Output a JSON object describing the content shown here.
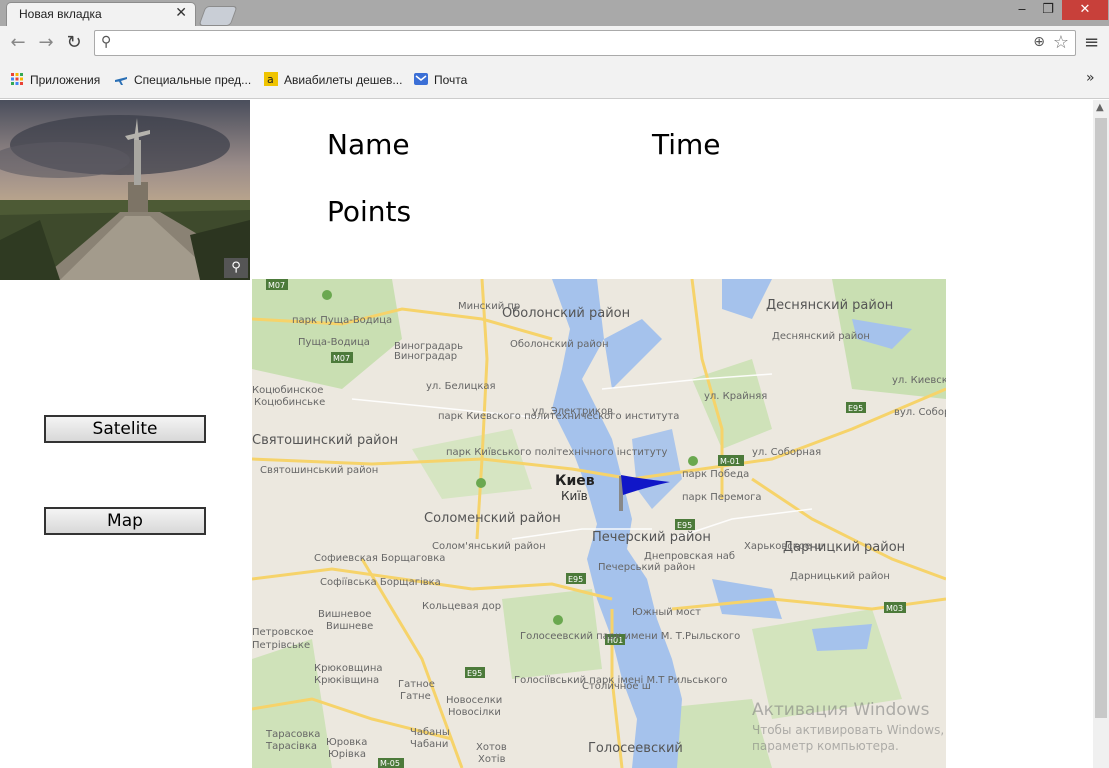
{
  "browser": {
    "tab_title": "Новая вкладка",
    "tab_close": "✕",
    "window_buttons": {
      "minimize": "‒",
      "maximize": "❐",
      "close": "✕"
    },
    "address_value": "",
    "bookmarks": [
      {
        "label": "Приложения",
        "icon": "apps-grid-icon",
        "color": "#e94235"
      },
      {
        "label": "Специальные пред...",
        "icon": "plane-icon",
        "color": "#2a6fb5"
      },
      {
        "label": "Авиабилеты дешев...",
        "icon": "amazon-a-icon",
        "color": "#f0c400"
      },
      {
        "label": "Почта",
        "icon": "mail-icon",
        "color": "#3b6fd6"
      }
    ],
    "bookmarks_more": "»"
  },
  "panel": {
    "name_label": "Name",
    "time_label": "Time",
    "points_label": "Points",
    "satellite_button": "Satelite",
    "map_button": "Map"
  },
  "map": {
    "labels": {
      "obolon": "Оболонский район",
      "obolon_small": "Оболонский район",
      "desnyan": "Деснянский район",
      "desnyan_small": "Деснянский район",
      "pushcha": "парк Пуща-Водица",
      "pushcha_small": "Пуща-Водица",
      "vinogradar": "Виноградарь",
      "vinogradar2": "Виноградар",
      "kotsyub": "Коцюбинское",
      "kotsyub2": "Коцюбинське",
      "svyatoshin": "Святошинский район",
      "svyatoshin_small": "Святошинський район",
      "kpi": "парк Киевского политехнического института",
      "kpi_small": "парк Київського політехнічного інституту",
      "kiev": "Киев",
      "kyiv": "Київ",
      "pobeda": "парк Победа",
      "peremoga": "парк Перемога",
      "solomen": "Соломенский район",
      "solomen_small": "Солом'янський район",
      "pechersk": "Печерский район",
      "pechersk_small": "Печерський район",
      "darnit": "Дарницкий район",
      "darnit_small": "Дарницький район",
      "sofiev": "Софиевская Борщаговка",
      "sofiev_small": "Софіївська Борщагівка",
      "vishnevoe": "Вишневое",
      "vishneve": "Вишневе",
      "petrov": "Петровское",
      "petriv": "Петрівське",
      "kryuk": "Крюковщина",
      "kryuk2": "Крюківщина",
      "gatnoe": "Гатное",
      "gatne": "Гатне",
      "novos": "Новоселки",
      "novos2": "Новосілки",
      "goloseev_park": "Голосеевский парк имени М. Т.Рыльского",
      "goloseev_park_small": "Голосіївський парк імені М.Т Рильського",
      "goloseev": "Голосеевский",
      "taras": "Тарасовка",
      "taras2": "Тарасівка",
      "yurov": "Юровка",
      "yuriv": "Юрівка",
      "chabany": "Чабаны",
      "chabany2": "Чабани",
      "khotov": "Хотов",
      "khotiv": "Хотів",
      "yuzhny": "Южный мост",
      "electric": "ул. Электриков",
      "belitska": "ул. Белицкая",
      "sobornaya": "ул. Соборная",
      "sobornaya2": "вул. Собор",
      "kiev_street": "ул. Киевская",
      "kraynyaya": "ул. Крайняя",
      "koltsevaya": "Кольцевая дор",
      "kharkov": "Харьковское ш",
      "dnipro_nab": "Днепровская наб",
      "stolichnoe": "Столичное ш",
      "minskiy": "Минский пр",
      "roads": [
        "M07",
        "M07",
        "E95",
        "M-01",
        "E95",
        "E95",
        "E95",
        "H01",
        "M03",
        "M-05"
      ]
    }
  },
  "watermark": {
    "title": "Активация Windows",
    "line1": "Чтобы активировать Windows,",
    "line2": "параметр компьютера."
  }
}
